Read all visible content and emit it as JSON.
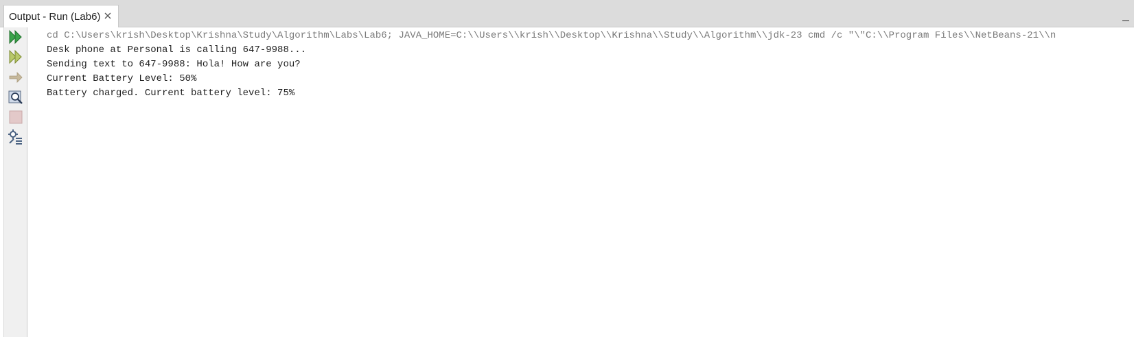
{
  "tab": {
    "title": "Output - Run (Lab6)",
    "close_icon": "close-icon"
  },
  "window": {
    "minimize_icon": "minimize-icon"
  },
  "toolbar": {
    "items": [
      {
        "name": "rerun-icon",
        "enabled": true
      },
      {
        "name": "rerun-with-params-icon",
        "enabled": true
      },
      {
        "name": "stop-icon-arrow",
        "enabled": false
      },
      {
        "name": "debug-inspect-icon",
        "enabled": true
      },
      {
        "name": "stop-icon",
        "enabled": false
      },
      {
        "name": "settings-icon",
        "enabled": true
      }
    ]
  },
  "output": {
    "command": "cd C:\\Users\\krish\\Desktop\\Krishna\\Study\\Algorithm\\Labs\\Lab6; JAVA_HOME=C:\\\\Users\\\\krish\\\\Desktop\\\\Krishna\\\\Study\\\\Algorithm\\\\jdk-23 cmd /c \"\\\"C:\\\\Program Files\\\\NetBeans-21\\\\n",
    "lines": [
      "Desk phone at Personal is calling 647-9988...",
      "Sending text to 647-9988: Hola! How are you?",
      "Current Battery Level: 50%",
      "Battery charged. Current battery level: 75%"
    ]
  },
  "colors": {
    "run_green": "#3aa34a",
    "tab_bar_bg": "#dcdcdc",
    "command_text": "#7a7a7a",
    "output_text": "#1e1e1e"
  }
}
